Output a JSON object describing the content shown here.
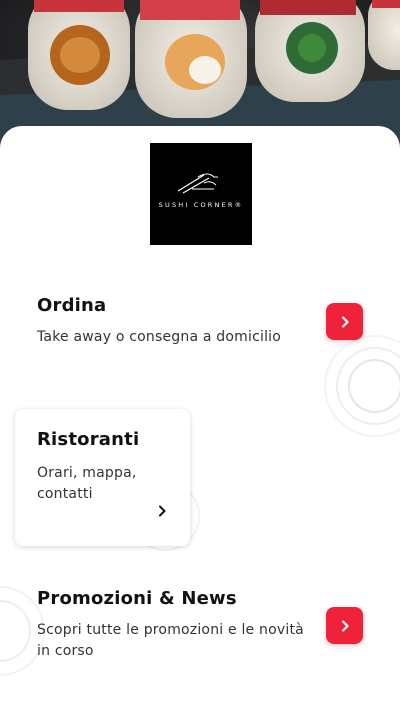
{
  "brand": {
    "logo_text": "SUSHI CORNER®",
    "colors": {
      "accent": "#f0223a",
      "logo_bg": "#000000",
      "sheet_bg": "#ffffff"
    }
  },
  "sections": [
    {
      "id": "ordina",
      "title": "Ordina",
      "description": "Take away o consegna a domicilio",
      "action_icon": "chevron-right-icon"
    },
    {
      "id": "ristoranti",
      "title": "Ristoranti",
      "description": "Orari, mappa, contatti",
      "action_icon": "chevron-right-icon"
    },
    {
      "id": "promozioni",
      "title": "Promozioni & News",
      "description": "Scopri tutte le promozioni e le novità in corso",
      "action_icon": "chevron-right-icon"
    }
  ],
  "hero": {
    "image": "sushi-rolls-photo"
  }
}
